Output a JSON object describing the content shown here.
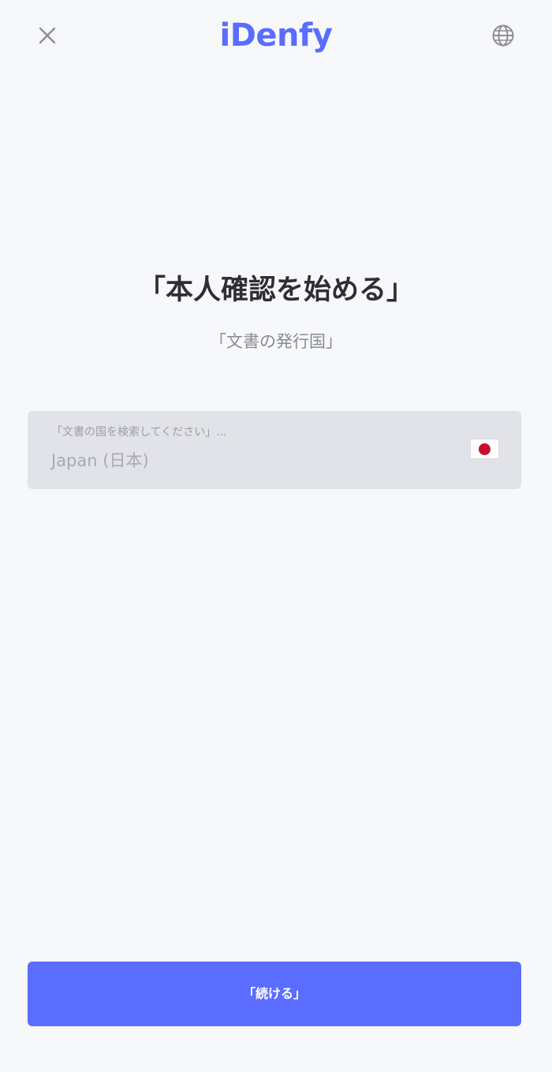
{
  "header": {
    "logo_text": "iDenfy",
    "close_icon": "close-icon",
    "language_icon": "globe-icon"
  },
  "main": {
    "title": "「本人確認を始める」",
    "subtitle": "「文書の発行国」"
  },
  "country_field": {
    "label": "「文書の国を検索してください」...",
    "value": "Japan (日本)",
    "flag_icon": "japan-flag-icon"
  },
  "footer": {
    "continue_label": "「続ける」"
  },
  "colors": {
    "accent": "#5a6dff",
    "background": "#f7f8fa",
    "field_background": "#e2e3e8",
    "title_text": "#2e2e33",
    "muted_text": "#8a8b92",
    "flag_red": "#c8102e"
  }
}
